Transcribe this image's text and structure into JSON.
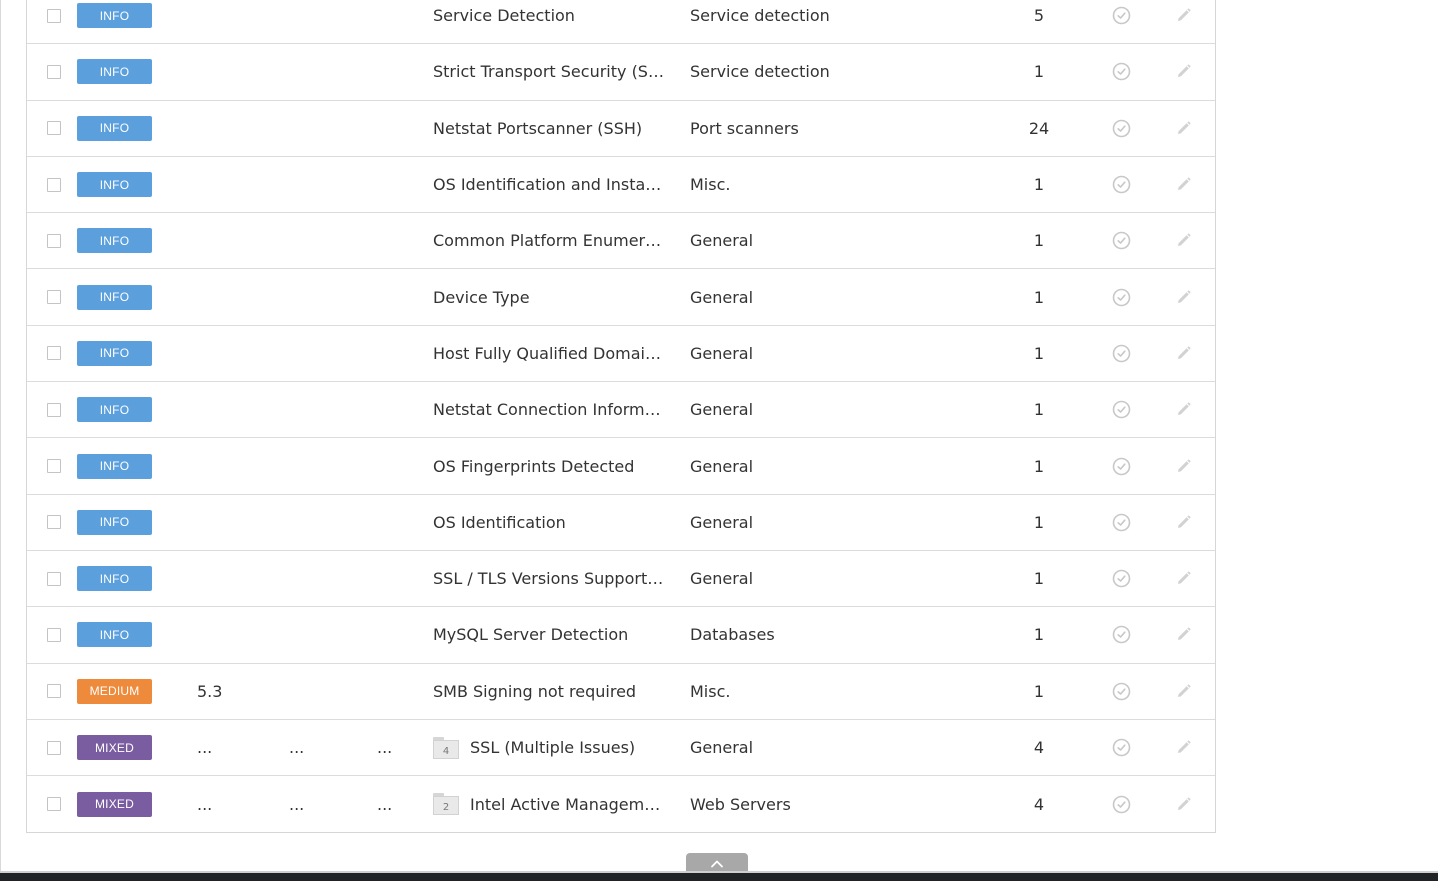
{
  "colors": {
    "info": "#5b9fdc",
    "medium": "#ee8a3b",
    "mixed": "#7a5da0",
    "icon_gray": "#c8c8c8"
  },
  "rows": [
    {
      "severity": "INFO",
      "severity_color": "#5b9fdc",
      "cvss": "",
      "vpr": "",
      "epss": "",
      "name": "Service Detection",
      "group_count": "",
      "family": "Service detection",
      "count": "5"
    },
    {
      "severity": "INFO",
      "severity_color": "#5b9fdc",
      "cvss": "",
      "vpr": "",
      "epss": "",
      "name": "Strict Transport Security (STS...",
      "group_count": "",
      "family": "Service detection",
      "count": "1"
    },
    {
      "severity": "INFO",
      "severity_color": "#5b9fdc",
      "cvss": "",
      "vpr": "",
      "epss": "",
      "name": "Netstat Portscanner (SSH)",
      "group_count": "",
      "family": "Port scanners",
      "count": "24"
    },
    {
      "severity": "INFO",
      "severity_color": "#5b9fdc",
      "cvss": "",
      "vpr": "",
      "epss": "",
      "name": "OS Identification and Installe...",
      "group_count": "",
      "family": "Misc.",
      "count": "1"
    },
    {
      "severity": "INFO",
      "severity_color": "#5b9fdc",
      "cvss": "",
      "vpr": "",
      "epss": "",
      "name": "Common Platform Enumerat...",
      "group_count": "",
      "family": "General",
      "count": "1"
    },
    {
      "severity": "INFO",
      "severity_color": "#5b9fdc",
      "cvss": "",
      "vpr": "",
      "epss": "",
      "name": "Device Type",
      "group_count": "",
      "family": "General",
      "count": "1"
    },
    {
      "severity": "INFO",
      "severity_color": "#5b9fdc",
      "cvss": "",
      "vpr": "",
      "epss": "",
      "name": "Host Fully Qualified Domain ...",
      "group_count": "",
      "family": "General",
      "count": "1"
    },
    {
      "severity": "INFO",
      "severity_color": "#5b9fdc",
      "cvss": "",
      "vpr": "",
      "epss": "",
      "name": "Netstat Connection Informat...",
      "group_count": "",
      "family": "General",
      "count": "1"
    },
    {
      "severity": "INFO",
      "severity_color": "#5b9fdc",
      "cvss": "",
      "vpr": "",
      "epss": "",
      "name": "OS Fingerprints Detected",
      "group_count": "",
      "family": "General",
      "count": "1"
    },
    {
      "severity": "INFO",
      "severity_color": "#5b9fdc",
      "cvss": "",
      "vpr": "",
      "epss": "",
      "name": "OS Identification",
      "group_count": "",
      "family": "General",
      "count": "1"
    },
    {
      "severity": "INFO",
      "severity_color": "#5b9fdc",
      "cvss": "",
      "vpr": "",
      "epss": "",
      "name": "SSL / TLS Versions Supported",
      "group_count": "",
      "family": "General",
      "count": "1"
    },
    {
      "severity": "INFO",
      "severity_color": "#5b9fdc",
      "cvss": "",
      "vpr": "",
      "epss": "",
      "name": "MySQL Server Detection",
      "group_count": "",
      "family": "Databases",
      "count": "1"
    },
    {
      "severity": "MEDIUM",
      "severity_color": "#ee8a3b",
      "cvss": "5.3",
      "vpr": "",
      "epss": "",
      "name": "SMB Signing not required",
      "group_count": "",
      "family": "Misc.",
      "count": "1"
    },
    {
      "severity": "MIXED",
      "severity_color": "#7a5da0",
      "cvss": "...",
      "vpr": "...",
      "epss": "...",
      "name": "SSL (Multiple Issues)",
      "group_count": "4",
      "family": "General",
      "count": "4"
    },
    {
      "severity": "MIXED",
      "severity_color": "#7a5da0",
      "cvss": "...",
      "vpr": "...",
      "epss": "...",
      "name": "Intel Active Manageme...",
      "group_count": "2",
      "family": "Web Servers",
      "count": "4"
    }
  ],
  "icons": {
    "status": "check-circle-icon",
    "edit": "pencil-icon",
    "group": "folder-icon",
    "collapse": "chevron-up-icon"
  }
}
